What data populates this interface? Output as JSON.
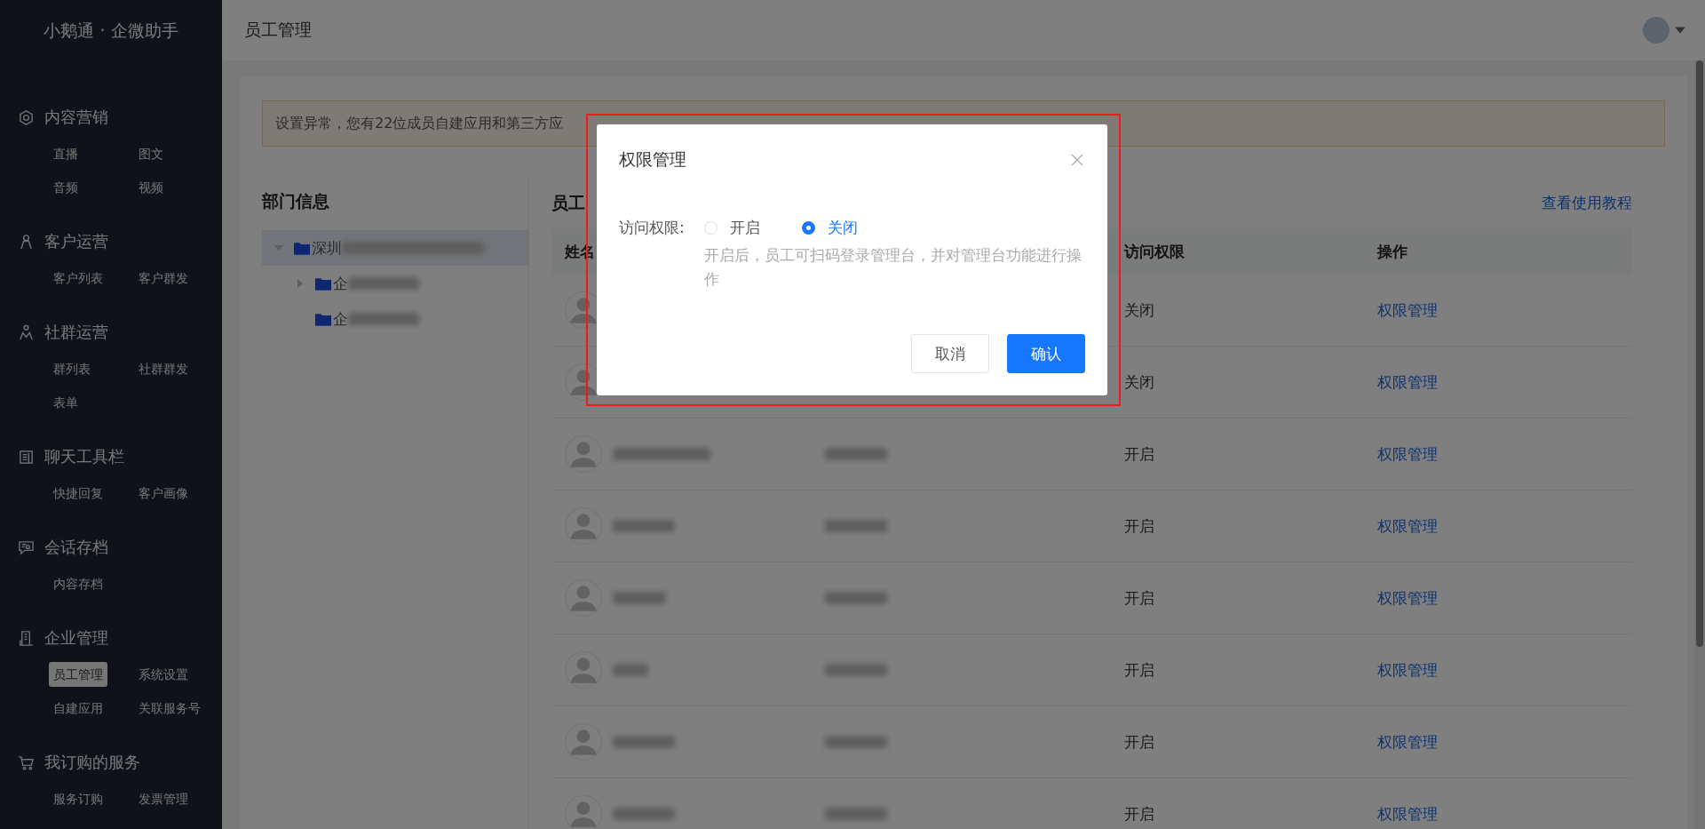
{
  "sidebar": {
    "brand": "小鹅通 · 企微助手",
    "sections": [
      {
        "title": "内容营销",
        "kind": "marketing",
        "items": [
          {
            "label": "直播",
            "selected": false
          },
          {
            "label": "图文",
            "selected": false
          },
          {
            "label": "音频",
            "selected": false
          },
          {
            "label": "视频",
            "selected": false
          }
        ]
      },
      {
        "title": "客户运营",
        "kind": "customer",
        "items": [
          {
            "label": "客户列表",
            "selected": false
          },
          {
            "label": "客户群发",
            "selected": false
          }
        ]
      },
      {
        "title": "社群运营",
        "kind": "community",
        "items": [
          {
            "label": "群列表",
            "selected": false
          },
          {
            "label": "社群群发",
            "selected": false
          },
          {
            "label": "表单",
            "selected": false
          }
        ]
      },
      {
        "title": "聊天工具栏",
        "kind": "toolbar",
        "items": [
          {
            "label": "快捷回复",
            "selected": false
          },
          {
            "label": "客户画像",
            "selected": false
          }
        ]
      },
      {
        "title": "会话存档",
        "kind": "archive",
        "items": [
          {
            "label": "内容存档",
            "selected": false
          }
        ]
      },
      {
        "title": "企业管理",
        "kind": "enterprise",
        "items": [
          {
            "label": "员工管理",
            "selected": true
          },
          {
            "label": "系统设置",
            "selected": false
          },
          {
            "label": "自建应用",
            "selected": false
          },
          {
            "label": "关联服务号",
            "selected": false
          }
        ]
      },
      {
        "title": "我订购的服务",
        "kind": "cart",
        "items": [
          {
            "label": "服务订购",
            "selected": false
          },
          {
            "label": "发票管理",
            "selected": false
          }
        ]
      }
    ]
  },
  "header": {
    "title": "员工管理"
  },
  "alert": "设置异常，您有22位成员自建应用和第三方应",
  "departments": {
    "title": "部门信息",
    "tree": [
      {
        "label": "深圳",
        "kind": "branch",
        "expanded": true,
        "selected": true,
        "children": [
          {
            "label": "企",
            "kind": "branch",
            "expanded": false,
            "selected": false
          },
          {
            "label": "企",
            "kind": "leaf",
            "selected": false
          }
        ]
      }
    ]
  },
  "employees": {
    "title": "员工",
    "tutorial_link": "查看使用教程",
    "columns": [
      "姓名",
      "访问权限",
      "操作"
    ],
    "rows": [
      {
        "access": "关闭",
        "action": "权限管理"
      },
      {
        "access": "关闭",
        "action": "权限管理"
      },
      {
        "access": "开启",
        "action": "权限管理"
      },
      {
        "access": "开启",
        "action": "权限管理"
      },
      {
        "access": "开启",
        "action": "权限管理"
      },
      {
        "access": "开启",
        "action": "权限管理"
      },
      {
        "access": "开启",
        "action": "权限管理"
      },
      {
        "access": "开启",
        "action": "权限管理"
      }
    ]
  },
  "dialog": {
    "title": "权限管理",
    "field_label": "访问权限:",
    "options": [
      {
        "label": "开启",
        "selected": false
      },
      {
        "label": "关闭",
        "selected": true
      }
    ],
    "hint": "开启后，员工可扫码登录管理台，并对管理台功能进行操作",
    "buttons": [
      {
        "label": "取消",
        "kind": "secondary"
      },
      {
        "label": "确认",
        "kind": "primary"
      }
    ]
  }
}
